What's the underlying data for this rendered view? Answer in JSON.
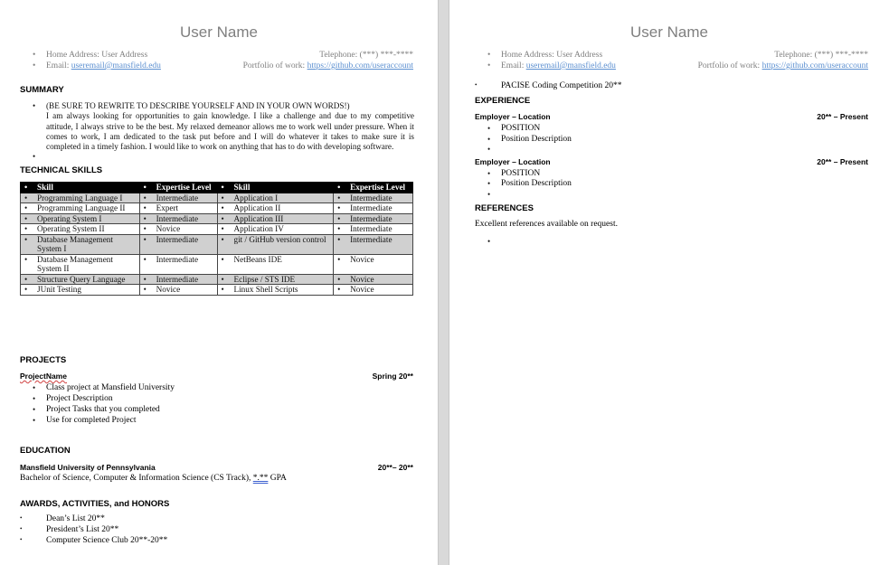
{
  "page1": {
    "name": "User Name",
    "contact": {
      "address": "Home Address: User Address",
      "email_label": "Email: ",
      "email": "useremail@mansfield.edu",
      "telephone": "Telephone: (***) ***-****",
      "portfolio_label": "Portfolio of work: ",
      "portfolio_url": "https://github.com/useraccount"
    },
    "summary": {
      "heading": "SUMMARY",
      "line1": "(BE SURE TO REWRITE TO DESCRIBE YOURSELF AND IN YOUR OWN WORDS!)",
      "paragraph": "I am always looking for opportunities to gain knowledge. I like a challenge and due to my competitive attitude, I always strive to be the best. My relaxed demeanor allows me to work well under pressure. When it comes to work, I am dedicated to the task put before and I will do whatever it takes to make sure it is completed in a timely fashion. I would like to work on anything that has to do with developing software."
    },
    "skills": {
      "heading": "TECHNICAL SKILLS",
      "headers": [
        "Skill",
        "Expertise Level",
        "Skill",
        "Expertise Level"
      ],
      "rows": [
        [
          "Programming Language I",
          "Intermediate",
          "Application I",
          "Intermediate"
        ],
        [
          "Programming Language II",
          "Expert",
          "Application II",
          "Intermediate"
        ],
        [
          "Operating System I",
          "Intermediate",
          "Application III",
          "Intermediate"
        ],
        [
          "Operating System II",
          "Novice",
          "Application IV",
          "Intermediate"
        ],
        [
          "Database Management System I",
          "Intermediate",
          "git / GitHub version control",
          "Intermediate"
        ],
        [
          "Database Management System II",
          "Intermediate",
          "NetBeans IDE",
          "Novice"
        ],
        [
          "Structure Query Language",
          "Intermediate",
          "Eclipse / STS IDE",
          "Novice"
        ],
        [
          "JUnit Testing",
          "Novice",
          "Linux Shell Scripts",
          "Novice"
        ]
      ]
    },
    "projects": {
      "heading": "PROJECTS",
      "name": "ProjectName",
      "date": "Spring 20**",
      "items": [
        "Class project at Mansfield University",
        "Project Description",
        "Project Tasks that you completed",
        "Use for completed Project"
      ]
    },
    "education": {
      "heading": "EDUCATION",
      "school": "Mansfield University of Pennsylvania",
      "dates": "20**– 20**",
      "degree": "Bachelor of Science, Computer & Information Science (CS Track), ",
      "gpa": "*.**",
      "gpa_suffix": " GPA"
    },
    "awards": {
      "heading": "AWARDS, ACTIVITIES, and HONORS",
      "items": [
        "Dean’s List 20**",
        "President’s List 20**",
        "Computer Science Club 20**-20**"
      ]
    }
  },
  "page2": {
    "name": "User Name",
    "contact": {
      "address": "Home Address: User Address",
      "email_label": "Email: ",
      "email": "useremail@mansfield.edu",
      "telephone": "Telephone: (***) ***-****",
      "portfolio_label": "Portfolio of work: ",
      "portfolio_url": "https://github.com/useraccount"
    },
    "award_cont": "PACISE Coding Competition 20**",
    "experience": {
      "heading": "EXPERIENCE",
      "jobs": [
        {
          "employer": "Employer – Location",
          "dates": "20** – Present",
          "position": "POSITION",
          "description": "Position Description"
        },
        {
          "employer": "Employer – Location",
          "dates": "20** – Present",
          "position": "POSITION",
          "description": "Position Description"
        }
      ]
    },
    "references": {
      "heading": "REFERENCES",
      "text": "Excellent references available on request."
    }
  }
}
